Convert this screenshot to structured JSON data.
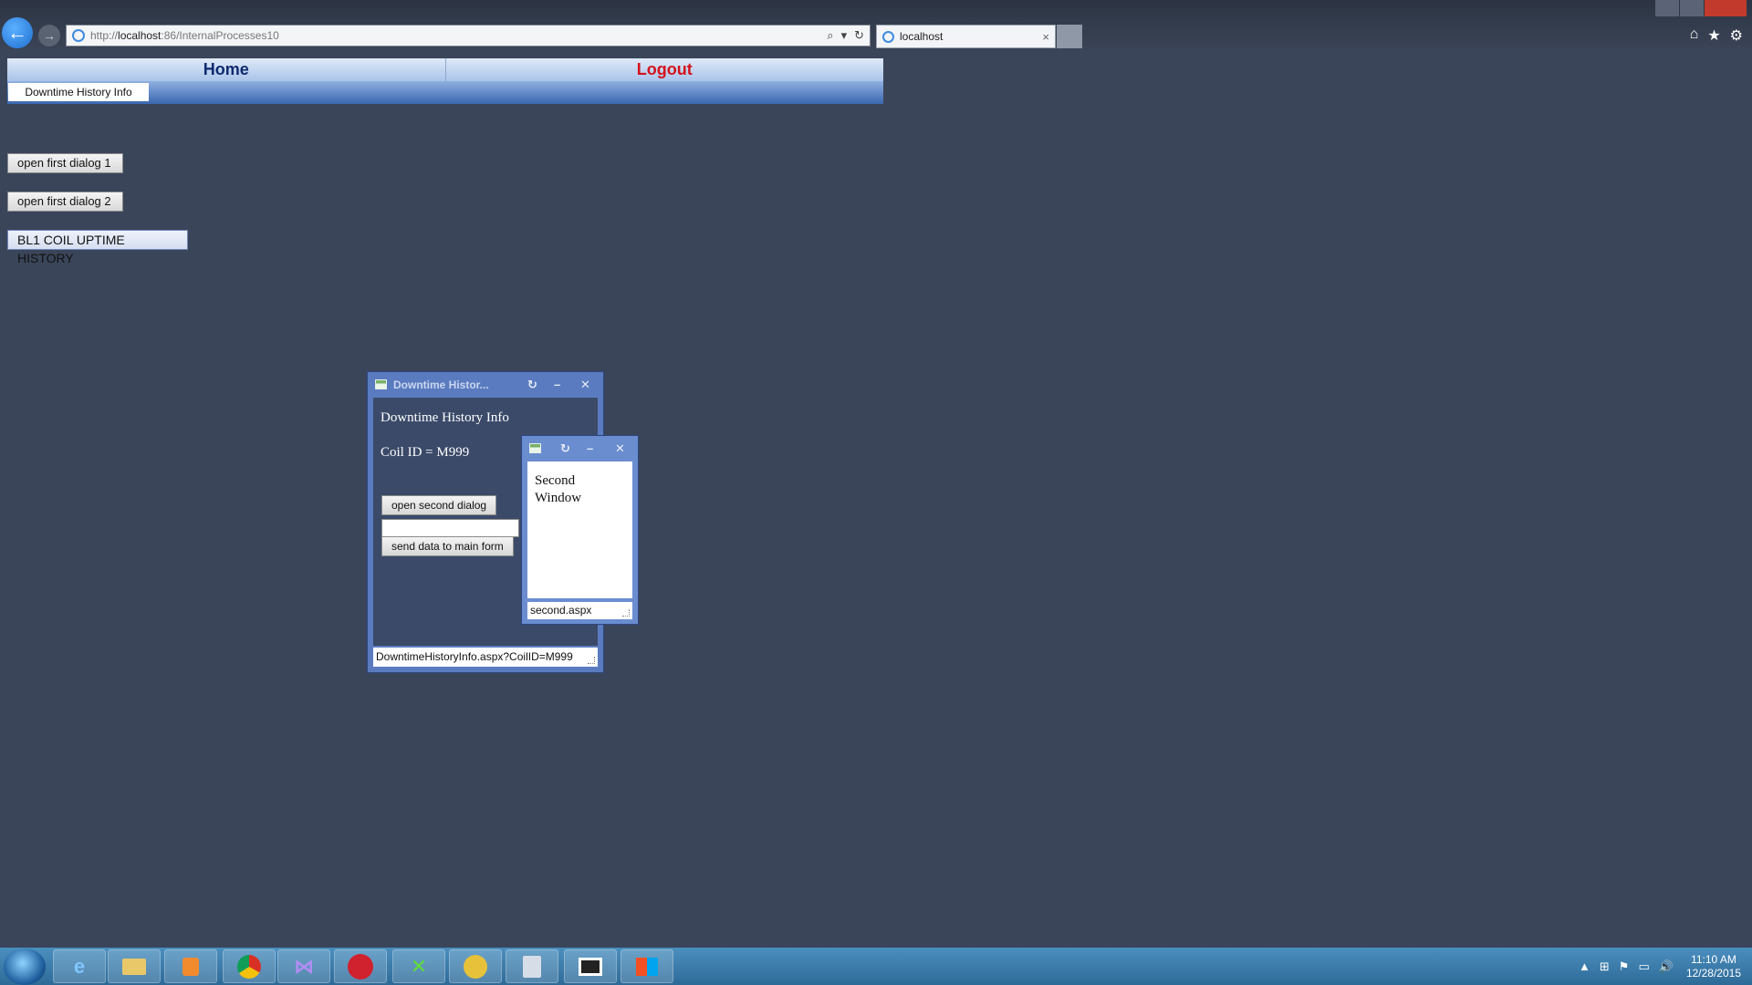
{
  "browser": {
    "url_prefix": "http://",
    "url_host": "localhost",
    "url_rest": ":86/InternalProcesses10",
    "tab_title": "localhost",
    "tab_close": "×",
    "search_glyph": "⌕",
    "dropdown_glyph": "▾",
    "refresh_glyph": "↻",
    "back_glyph": "←",
    "forward_glyph": "→",
    "home_glyph": "⌂",
    "favorites_glyph": "★",
    "settings_glyph": "⚙"
  },
  "menu": {
    "home": "Home",
    "logout": "Logout",
    "submenu": "Downtime History Info"
  },
  "page": {
    "buttons": [
      "open first dialog 1",
      "open first dialog 2",
      "BL1 COIL UPTIME HISTORY"
    ]
  },
  "dialog1": {
    "title": "Downtime Histor...",
    "heading": "Downtime History Info",
    "coil": "Coil ID = M999",
    "open_second": "open second dialog",
    "input_value": "",
    "send": "send data to main form",
    "status": "DowntimeHistoryInfo.aspx?CoilID=M999",
    "refresh_glyph": "↻",
    "minimize_glyph": "–",
    "close_glyph": "✕"
  },
  "dialog2": {
    "text_line1": "Second",
    "text_line2": "Window",
    "status": "second.aspx",
    "refresh_glyph": "↻",
    "minimize_glyph": "–",
    "close_glyph": "✕"
  },
  "taskbar": {
    "time": "11:10 AM",
    "date": "12/28/2015",
    "apps": [
      "internet-explorer",
      "file-explorer",
      "media-player",
      "chrome",
      "visual-studio",
      "mail",
      "app-green",
      "app-yellow",
      "calculator",
      "window",
      "remote-desktop"
    ],
    "tray_glyphs": [
      "▲",
      "⊞",
      "⚑",
      "▭",
      "🔊"
    ]
  },
  "colors": {
    "page_bg": "#3a4559",
    "home": "#0e2a70",
    "logout": "#d3131c",
    "dialog_frame": "#5a7bbf"
  }
}
